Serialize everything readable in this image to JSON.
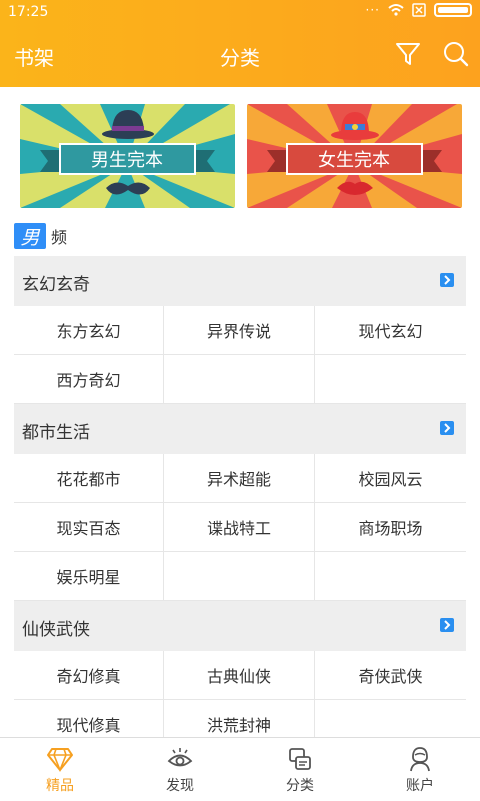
{
  "status_bar": {
    "time": "17:25"
  },
  "appbar": {
    "left_label": "书架",
    "title": "分类"
  },
  "banners": [
    {
      "label": "男生完本"
    },
    {
      "label": "女生完本"
    }
  ],
  "gender": {
    "badge": "男",
    "suffix": "频"
  },
  "sections": [
    {
      "title": "玄幻玄奇",
      "items": [
        "东方玄幻",
        "异界传说",
        "现代玄幻",
        "西方奇幻",
        "",
        ""
      ]
    },
    {
      "title": "都市生活",
      "items": [
        "花花都市",
        "异术超能",
        "校园风云",
        "现实百态",
        "谍战特工",
        "商场职场",
        "娱乐明星",
        "",
        ""
      ]
    },
    {
      "title": "仙侠武侠",
      "items": [
        "奇幻修真",
        "古典仙侠",
        "奇侠武侠",
        "现代修真",
        "洪荒封神",
        ""
      ]
    }
  ],
  "bottom_nav": [
    {
      "label": "精品",
      "active": true
    },
    {
      "label": "发现",
      "active": false
    },
    {
      "label": "分类",
      "active": false
    },
    {
      "label": "账户",
      "active": false
    }
  ],
  "colors": {
    "accent": "#fbb41a",
    "active_nav": "#f6a021",
    "badge_blue": "#2f8ef7"
  }
}
